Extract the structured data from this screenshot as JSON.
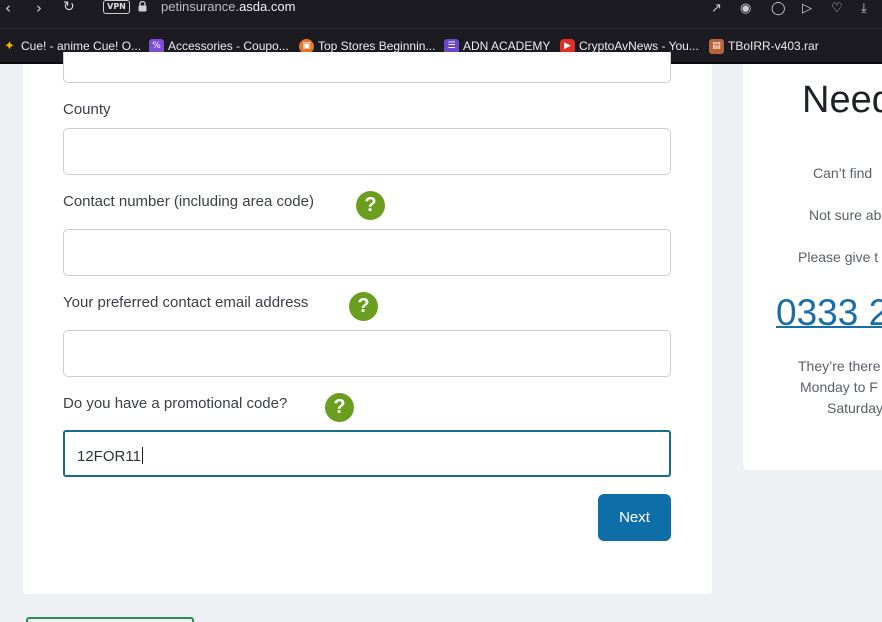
{
  "browser": {
    "vpn_label": "VPN",
    "url_prefix": "petinsurance.",
    "url_domain": "asda.com",
    "bookmarks": [
      {
        "label": "Cue! - anime Cue! O...",
        "icon": "sparkle-icon",
        "color": "#f0b400"
      },
      {
        "label": "Accessories - Coupo...",
        "icon": "percent-tag-icon",
        "color": "#7a4fd6"
      },
      {
        "label": "Top Stores Beginnin...",
        "icon": "shop-icon",
        "color": "#e8742a"
      },
      {
        "label": "ADN ACADEMY",
        "icon": "list-icon",
        "color": "#6a48c9"
      },
      {
        "label": "CryptoAvNews - You...",
        "icon": "youtube-icon",
        "color": "#e52d27"
      },
      {
        "label": "TBoIRR-v403.rar",
        "icon": "archive-icon",
        "color": "#b8643a"
      }
    ]
  },
  "form": {
    "county_label": "County",
    "county_value": "",
    "contact_number_label": "Contact number (including area code)",
    "contact_number_value": "",
    "email_label": "Your preferred contact email address",
    "email_value": "",
    "promo_label": "Do you have a promotional code?",
    "promo_value": "12FOR11",
    "help_glyph": "?",
    "next_label": "Next"
  },
  "help_panel": {
    "heading": "Need",
    "line1": "Can’t find",
    "line2": "Not sure ab",
    "line3": "Please give t",
    "phone": "0333 2",
    "hours1": "They’re there",
    "hours2": "Monday to F",
    "hours3": "Saturday"
  },
  "colors": {
    "accent": "#0e6fa8",
    "help_icon": "#6b9e1f",
    "active_border": "#1b6c87"
  }
}
